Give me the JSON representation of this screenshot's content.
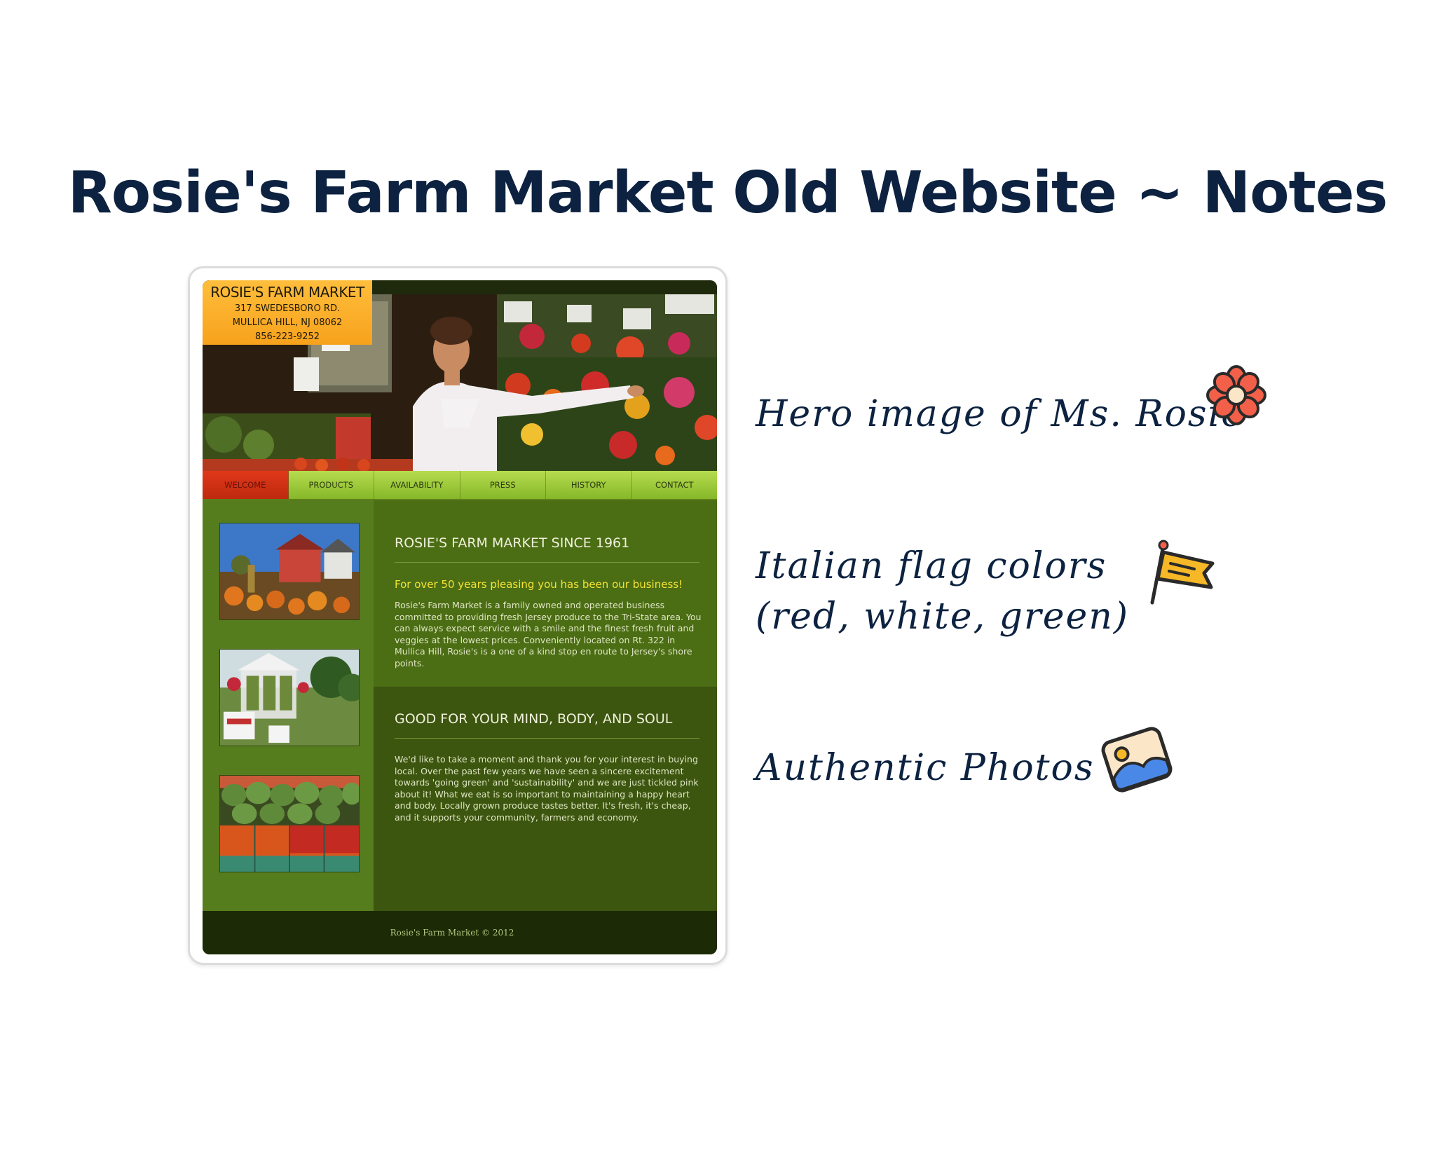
{
  "page": {
    "title": "Rosie's Farm Market Old Website ~ Notes"
  },
  "site": {
    "address": {
      "name": "ROSIE'S FARM MARKET",
      "street": "317 SWEDESBORO RD.",
      "city": "MULLICA HILL, NJ 08062",
      "phone": "856-223-9252"
    },
    "nav": [
      {
        "label": "WELCOME",
        "active": true
      },
      {
        "label": "PRODUCTS",
        "active": false
      },
      {
        "label": "AVAILABILITY",
        "active": false
      },
      {
        "label": "PRESS",
        "active": false
      },
      {
        "label": "HISTORY",
        "active": false
      },
      {
        "label": "CONTACT",
        "active": false
      }
    ],
    "section1": {
      "heading": "ROSIE'S FARM MARKET SINCE 1961",
      "tagline": "For over 50 years pleasing you has been our business!",
      "body": "Rosie's Farm Market is a family owned and operated business committed to providing fresh Jersey produce to the Tri-State area. You can always expect service with a smile and the finest fresh fruit and veggies at the lowest prices. Conveniently located on Rt. 322 in Mullica Hill, Rosie's is a one of a kind stop en route to Jersey's shore points."
    },
    "section2": {
      "heading": "GOOD FOR YOUR MIND, BODY, AND SOUL",
      "body": "We'd like to take a moment and thank you for your interest in buying local. Over the past few years we have seen a sincere excitement towards 'going green' and 'sustainability' and we are just tickled pink about it! What we eat is so important to maintaining a happy heart and body. Locally grown produce tastes better. It's fresh, it's cheap, and it supports your community, farmers and economy."
    },
    "footer": "Rosie's Farm Market © 2012",
    "colors": {
      "nav_active": "#d2321a",
      "nav": "#a3cf3e",
      "panel_green": "#4b6d14",
      "address_orange": "#ffb531"
    }
  },
  "notes": [
    {
      "line1": "Hero image of Ms. Rosie",
      "icon": "flower-icon"
    },
    {
      "line1": "Italian flag colors",
      "line2": "(red, white, green)",
      "icon": "flag-icon"
    },
    {
      "line1": "Authentic Photos",
      "icon": "photo-icon"
    }
  ]
}
